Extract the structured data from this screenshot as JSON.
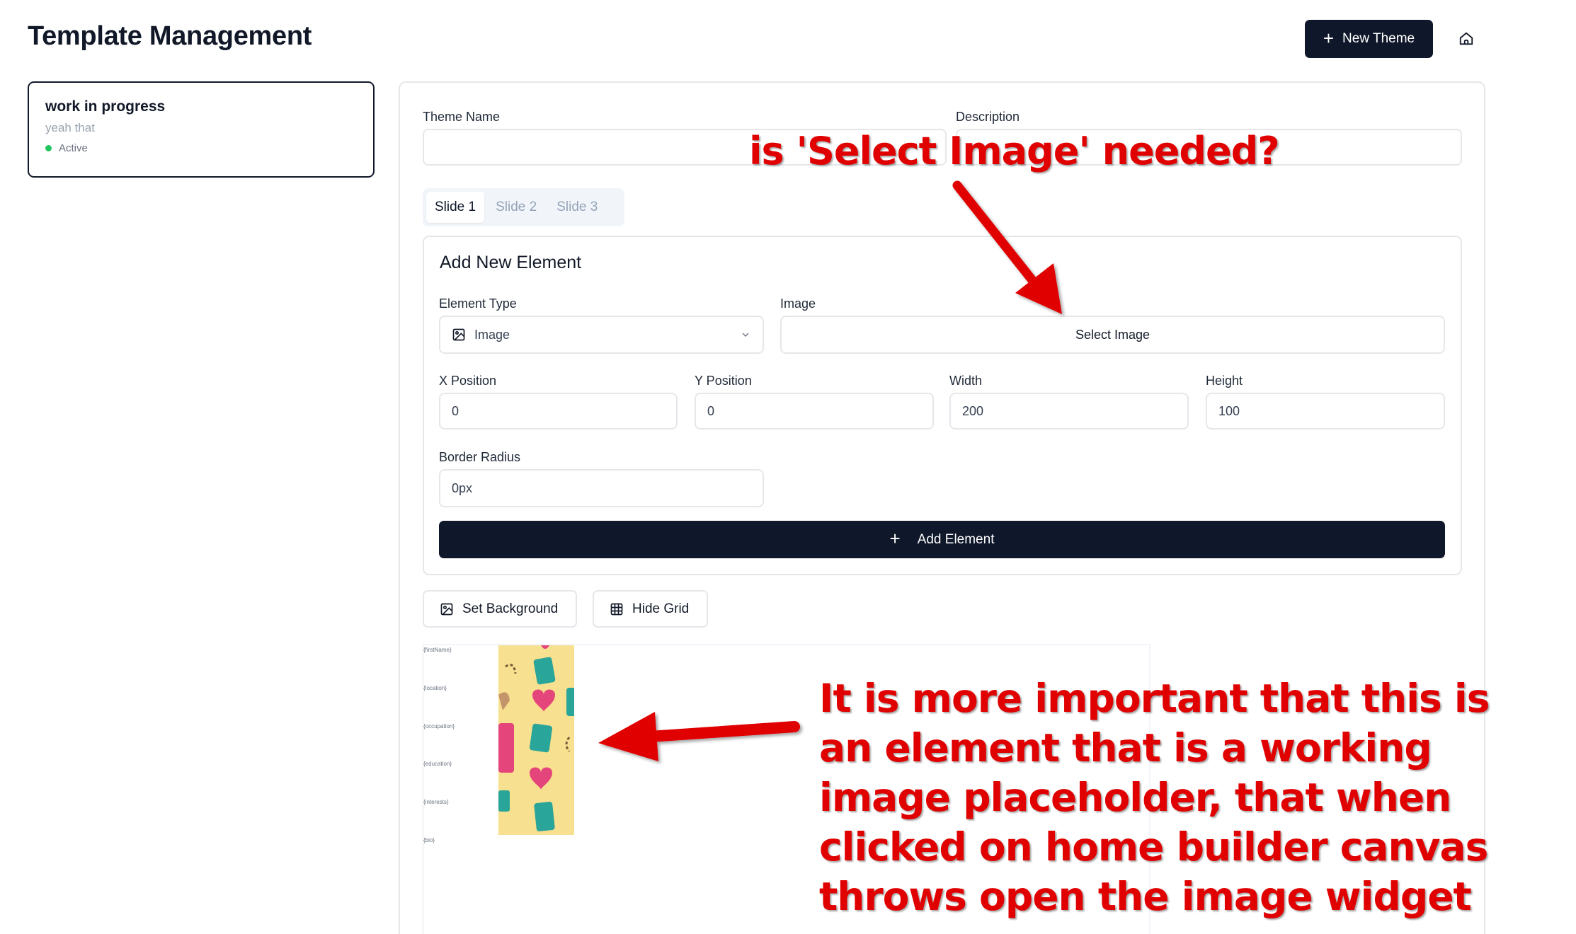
{
  "header": {
    "title": "Template Management",
    "new_theme_label": "New Theme",
    "home_icon": "home-icon"
  },
  "theme_list": [
    {
      "name": "work in progress",
      "description": "yeah that",
      "status": "Active",
      "status_color": "#22c55e"
    }
  ],
  "form": {
    "theme_name_label": "Theme Name",
    "theme_name_value": "",
    "description_label": "Description",
    "description_value": ""
  },
  "slides": {
    "tabs": [
      "Slide 1",
      "Slide 2",
      "Slide 3"
    ],
    "active_tab": "Slide 1"
  },
  "add_element": {
    "title": "Add New Element",
    "element_type_label": "Element Type",
    "element_type_value": "Image",
    "image_label": "Image",
    "select_image_label": "Select Image",
    "x_label": "X Position",
    "x_value": "0",
    "y_label": "Y Position",
    "y_value": "0",
    "width_label": "Width",
    "width_value": "200",
    "height_label": "Height",
    "height_value": "100",
    "border_radius_label": "Border Radius",
    "border_radius_value": "0px",
    "add_button_label": "Add Element"
  },
  "toolbar": {
    "set_background_label": "Set Background",
    "hide_grid_label": "Hide Grid"
  },
  "canvas": {
    "placeholders": [
      "{firstName}",
      "{location}",
      "{occupation}",
      "{education}",
      "{interests}",
      "{bio}"
    ]
  },
  "annotations": {
    "question": "is 'Select Image' needed?",
    "note_lines": [
      "It is more important that this is",
      "an element that is a working",
      "image placeholder, that when",
      "clicked on home builder canvas",
      "throws open the image widget"
    ],
    "color": "#e00000"
  },
  "colors": {
    "primary": "#0f172a",
    "border": "#e5e7eb",
    "active_green": "#22c55e"
  }
}
